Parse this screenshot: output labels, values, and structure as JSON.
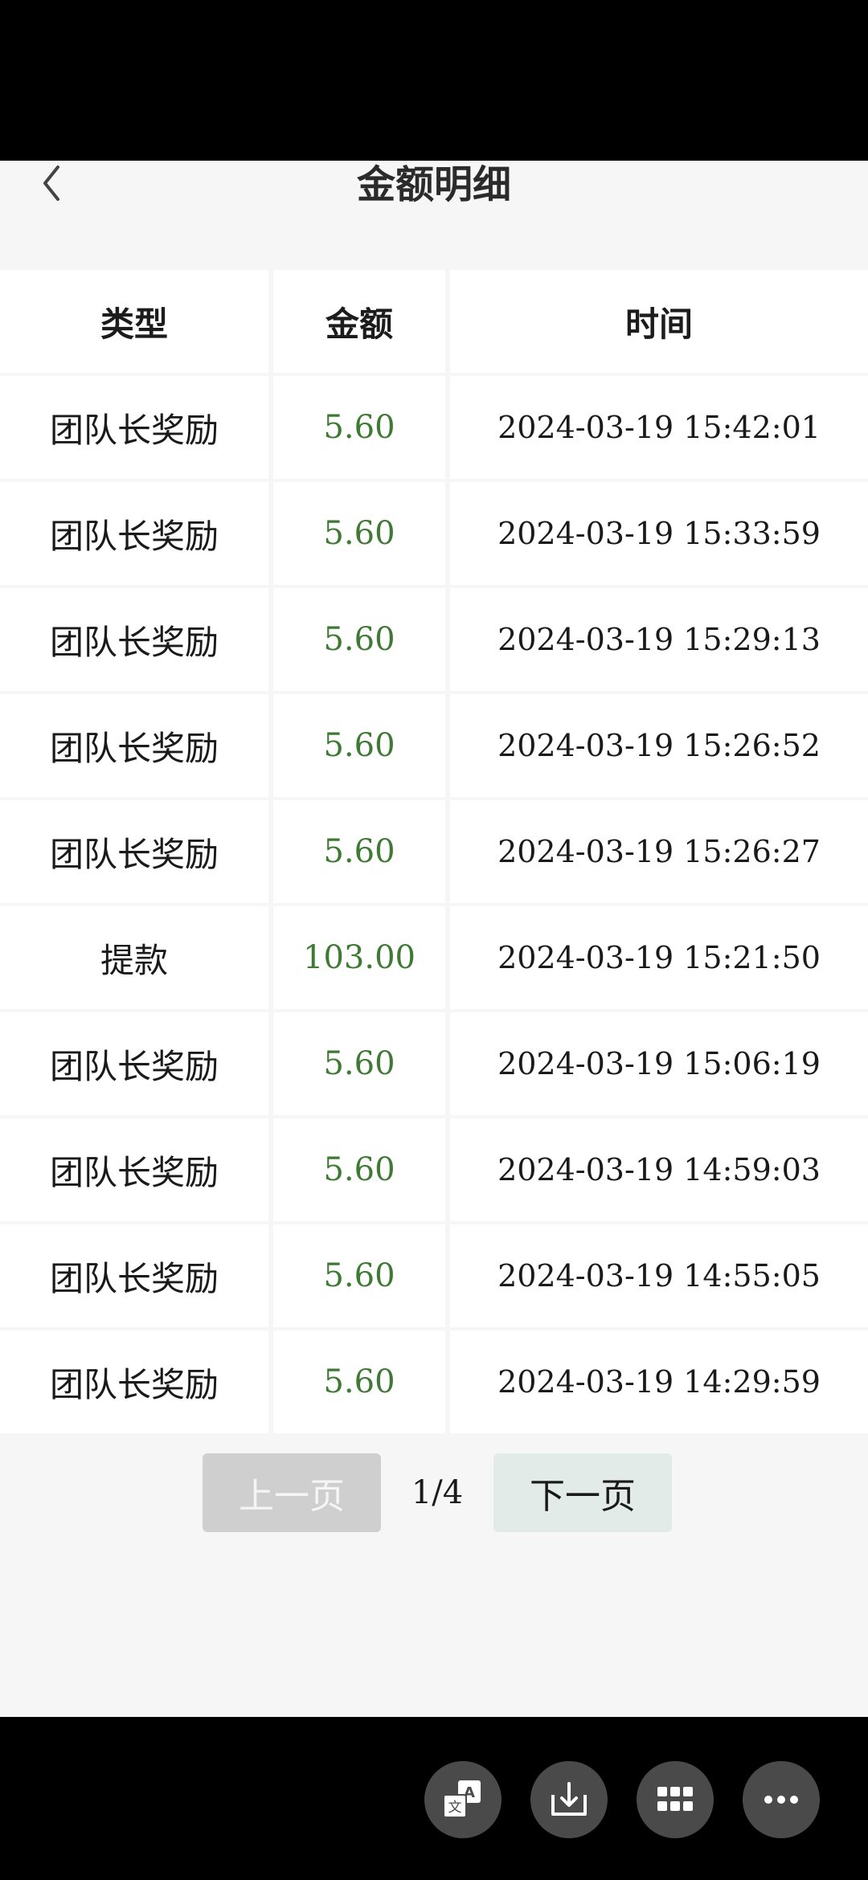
{
  "header": {
    "title": "金额明细"
  },
  "table": {
    "columns": [
      "类型",
      "金额",
      "时间"
    ],
    "rows": [
      {
        "type": "团队长奖励",
        "amount": "5.60",
        "time": "2024-03-19 15:42:01"
      },
      {
        "type": "团队长奖励",
        "amount": "5.60",
        "time": "2024-03-19 15:33:59"
      },
      {
        "type": "团队长奖励",
        "amount": "5.60",
        "time": "2024-03-19 15:29:13"
      },
      {
        "type": "团队长奖励",
        "amount": "5.60",
        "time": "2024-03-19 15:26:52"
      },
      {
        "type": "团队长奖励",
        "amount": "5.60",
        "time": "2024-03-19 15:26:27"
      },
      {
        "type": "提款",
        "amount": "103.00",
        "time": "2024-03-19 15:21:50"
      },
      {
        "type": "团队长奖励",
        "amount": "5.60",
        "time": "2024-03-19 15:06:19"
      },
      {
        "type": "团队长奖励",
        "amount": "5.60",
        "time": "2024-03-19 14:59:03"
      },
      {
        "type": "团队长奖励",
        "amount": "5.60",
        "time": "2024-03-19 14:55:05"
      },
      {
        "type": "团队长奖励",
        "amount": "5.60",
        "time": "2024-03-19 14:29:59"
      }
    ]
  },
  "pager": {
    "prev_label": "上一页",
    "page": "1/4",
    "next_label": "下一页"
  },
  "floating_buttons": [
    {
      "icon": "translate-icon"
    },
    {
      "icon": "download-icon"
    },
    {
      "icon": "grid-icon"
    },
    {
      "icon": "more-icon"
    }
  ],
  "colors": {
    "amount": "#3f7a34",
    "background": "#f6f6f6",
    "cell": "#ffffff",
    "prev_disabled": "#cfcfcf",
    "next": "#e3ebe8"
  }
}
